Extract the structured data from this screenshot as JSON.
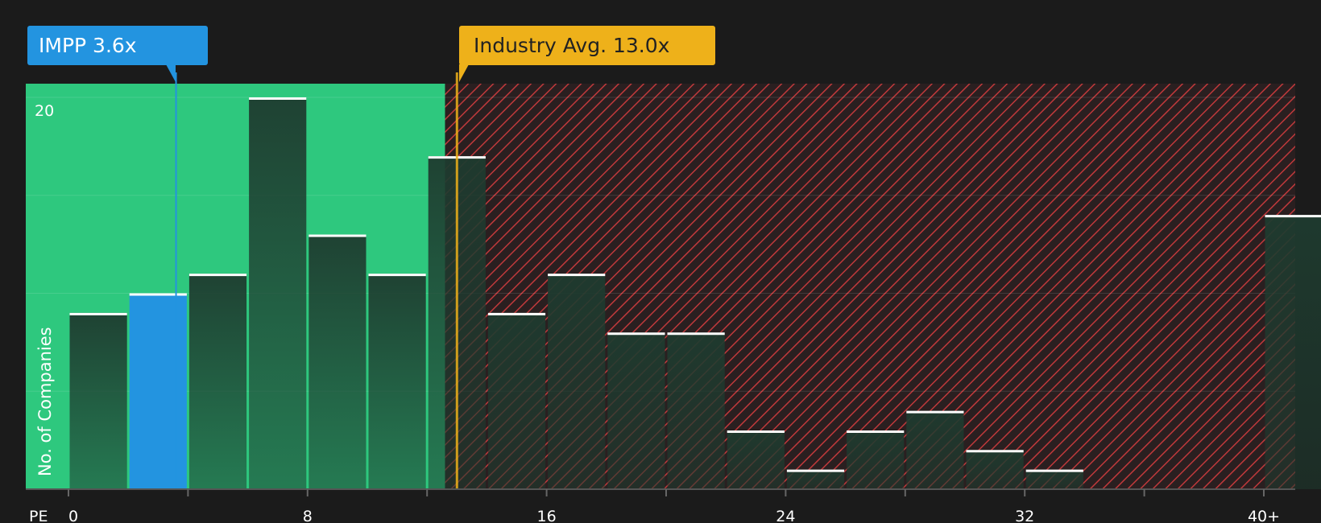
{
  "company_marker": {
    "label": "IMPP 3.6x",
    "value": 3.6
  },
  "industry_marker": {
    "label": "Industry Avg. 13.0x",
    "value": 13.0
  },
  "colors": {
    "background": "#1b1b1b",
    "undervalued_zone": "#2ec87e",
    "overvalued_hatch": "#c0393b",
    "bar_dark": "#1f3a2e",
    "company_bar": "#2394e0",
    "industry_line": "#eeb11a",
    "bar_cap": "#ffffff"
  },
  "chart_data": {
    "type": "bar",
    "title": "",
    "xlabel": "PE",
    "ylabel": "No. of Companies",
    "x_ticks": [
      "0",
      "8",
      "16",
      "24",
      "32",
      "40+"
    ],
    "y_ticks": [
      "20"
    ],
    "xlim": [
      0,
      41
    ],
    "ylim": [
      0,
      20.7
    ],
    "bin_width": 2,
    "bins": [
      {
        "start": 0,
        "count": 9
      },
      {
        "start": 2,
        "count": 10,
        "highlight": true
      },
      {
        "start": 4,
        "count": 11
      },
      {
        "start": 6,
        "count": 20
      },
      {
        "start": 8,
        "count": 13
      },
      {
        "start": 10,
        "count": 11
      },
      {
        "start": 12,
        "count": 17
      },
      {
        "start": 14,
        "count": 9
      },
      {
        "start": 16,
        "count": 11
      },
      {
        "start": 18,
        "count": 8
      },
      {
        "start": 20,
        "count": 8
      },
      {
        "start": 22,
        "count": 3
      },
      {
        "start": 24,
        "count": 1
      },
      {
        "start": 26,
        "count": 3
      },
      {
        "start": 28,
        "count": 4
      },
      {
        "start": 30,
        "count": 2
      },
      {
        "start": 32,
        "count": 1
      },
      {
        "start": 34,
        "count": 0
      },
      {
        "start": 36,
        "count": 0
      },
      {
        "start": 38,
        "count": 0
      },
      {
        "start": 40,
        "count": 14
      }
    ],
    "undervalued_until": 12.6,
    "grid": true
  }
}
